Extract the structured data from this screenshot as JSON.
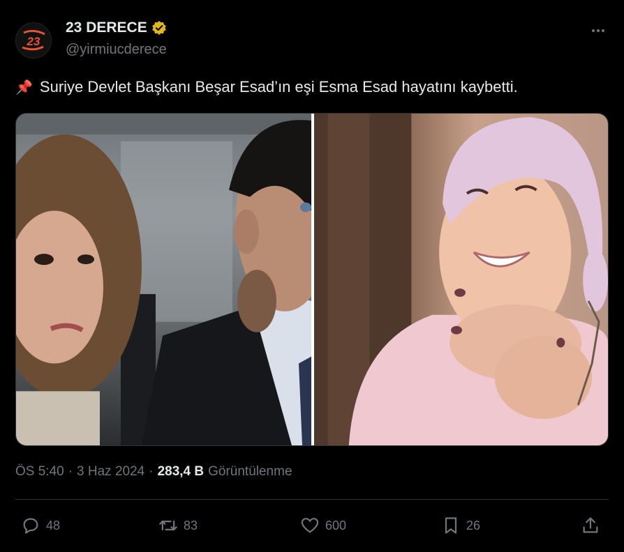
{
  "account": {
    "name": "23 DERECE",
    "handle": "@yirmiucderece",
    "logo_text": "23",
    "verified_color": "#e2b719"
  },
  "tweet": {
    "pin_emoji": "📌",
    "text": "Suriye Devlet Başkanı Beşar Esad’ın eşi Esma Esad hayatını kaybetti."
  },
  "meta": {
    "time": "ÖS 5:40",
    "date": "3 Haz 2024",
    "separator": "·",
    "views_count": "283,4 B",
    "views_label": "Görüntülenme"
  },
  "actions": {
    "replies": "48",
    "reposts": "83",
    "likes": "600",
    "bookmarks": "26"
  },
  "colors": {
    "background": "#000000",
    "text_primary": "#e7e9ea",
    "text_secondary": "#71767b",
    "logo_orange": "#e8542a"
  }
}
